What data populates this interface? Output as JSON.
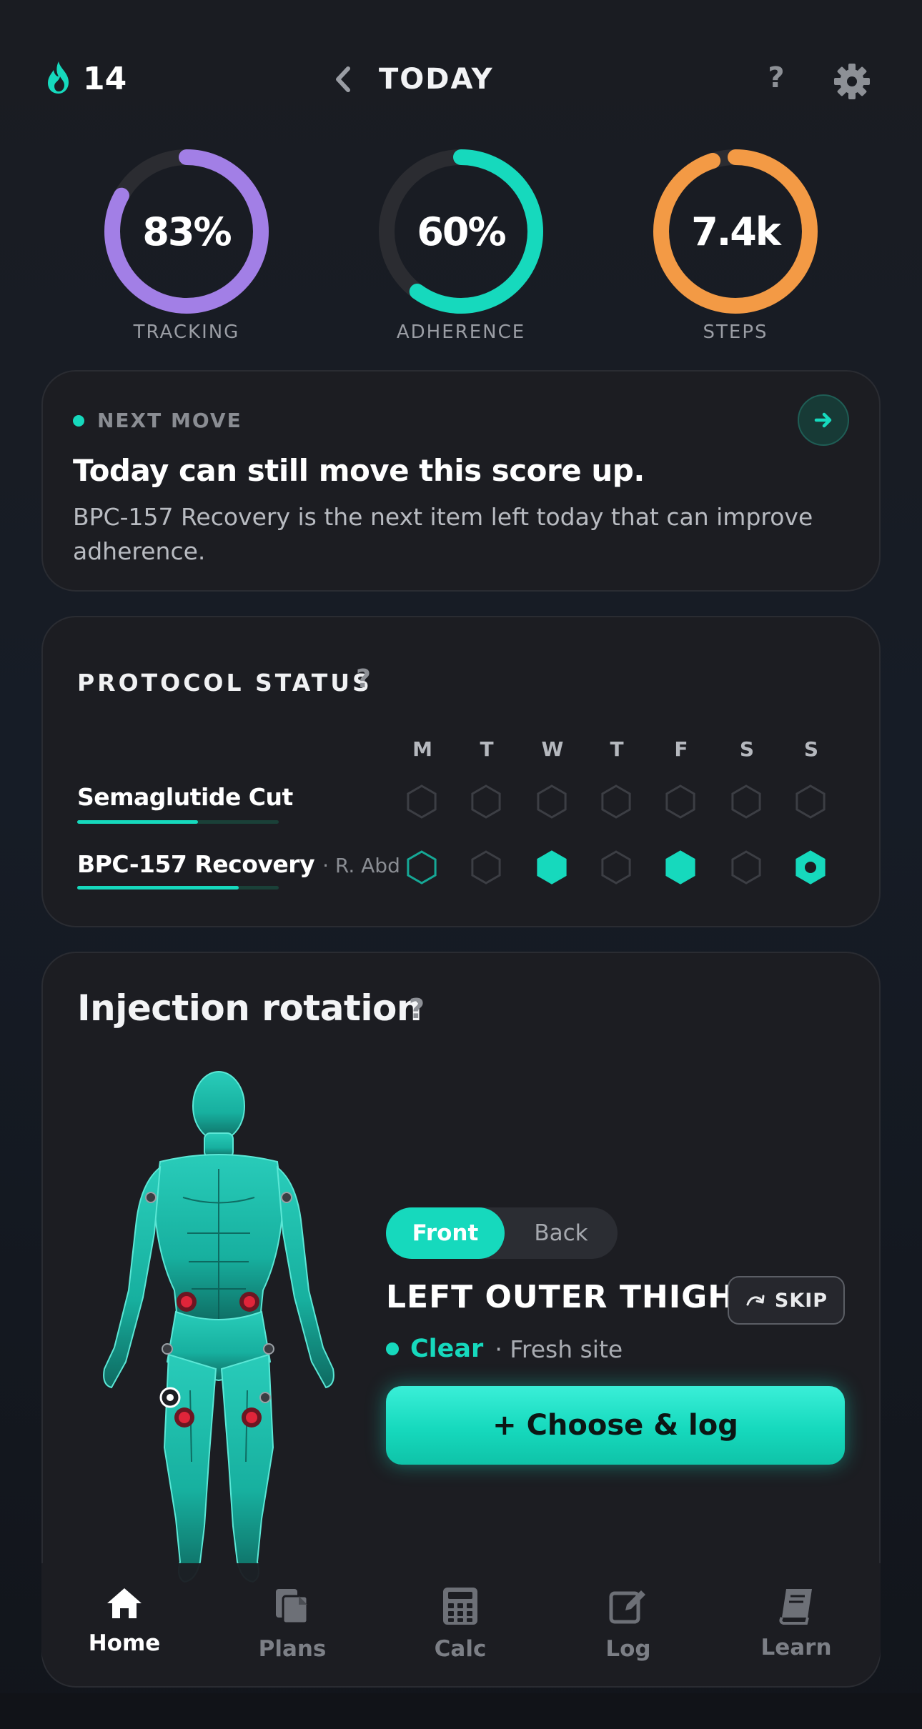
{
  "header": {
    "streak_count": "14",
    "title": "TODAY",
    "help_label": "?"
  },
  "rings": [
    {
      "value_text": "83%",
      "label": "TRACKING",
      "fraction": 0.83,
      "color": "#a27fe6"
    },
    {
      "value_text": "60%",
      "label": "ADHERENCE",
      "fraction": 0.6,
      "color": "#16d9bd"
    },
    {
      "value_text": "7.4k",
      "label": "STEPS",
      "fraction": 0.95,
      "color": "#f39a45"
    }
  ],
  "next_move": {
    "eyebrow": "NEXT MOVE",
    "title": "Today can still move this score up.",
    "body": "BPC-157 Recovery is the next item left today that can improve adherence."
  },
  "protocol_status": {
    "title": "PROTOCOL STATUS",
    "help_label": "?",
    "days": [
      "M",
      "T",
      "W",
      "T",
      "F",
      "S",
      "S"
    ],
    "rows": [
      {
        "name": "Semaglutide Cut",
        "sub": "",
        "progress": 0.6,
        "states": [
          "empty",
          "empty",
          "empty",
          "empty",
          "empty",
          "empty",
          "empty"
        ]
      },
      {
        "name": "BPC-157 Recovery",
        "sub": "· R. Abd",
        "progress": 0.8,
        "states": [
          "outline",
          "empty",
          "filled",
          "empty",
          "filled",
          "empty",
          "current"
        ]
      }
    ]
  },
  "injection_rotation": {
    "title": "Injection rotation",
    "help_label": "?",
    "view_toggle": {
      "front": "Front",
      "back": "Back",
      "selected": "Front"
    },
    "site_name": "LEFT OUTER THIGH",
    "skip_label": "SKIP",
    "status": "Clear",
    "status_note": "· Fresh site",
    "cta_label": "+ Choose & log"
  },
  "bottom_nav": [
    {
      "label": "Home",
      "icon": "home-icon",
      "active": true
    },
    {
      "label": "Plans",
      "icon": "plans-icon",
      "active": false
    },
    {
      "label": "Calc",
      "icon": "calculator-icon",
      "active": false
    },
    {
      "label": "Log",
      "icon": "edit-log-icon",
      "active": false
    },
    {
      "label": "Learn",
      "icon": "book-icon",
      "active": false
    }
  ],
  "colors": {
    "accent": "#16d9bd",
    "tracking": "#a27fe6",
    "steps": "#f39a45",
    "site_used": "#e0253a"
  }
}
